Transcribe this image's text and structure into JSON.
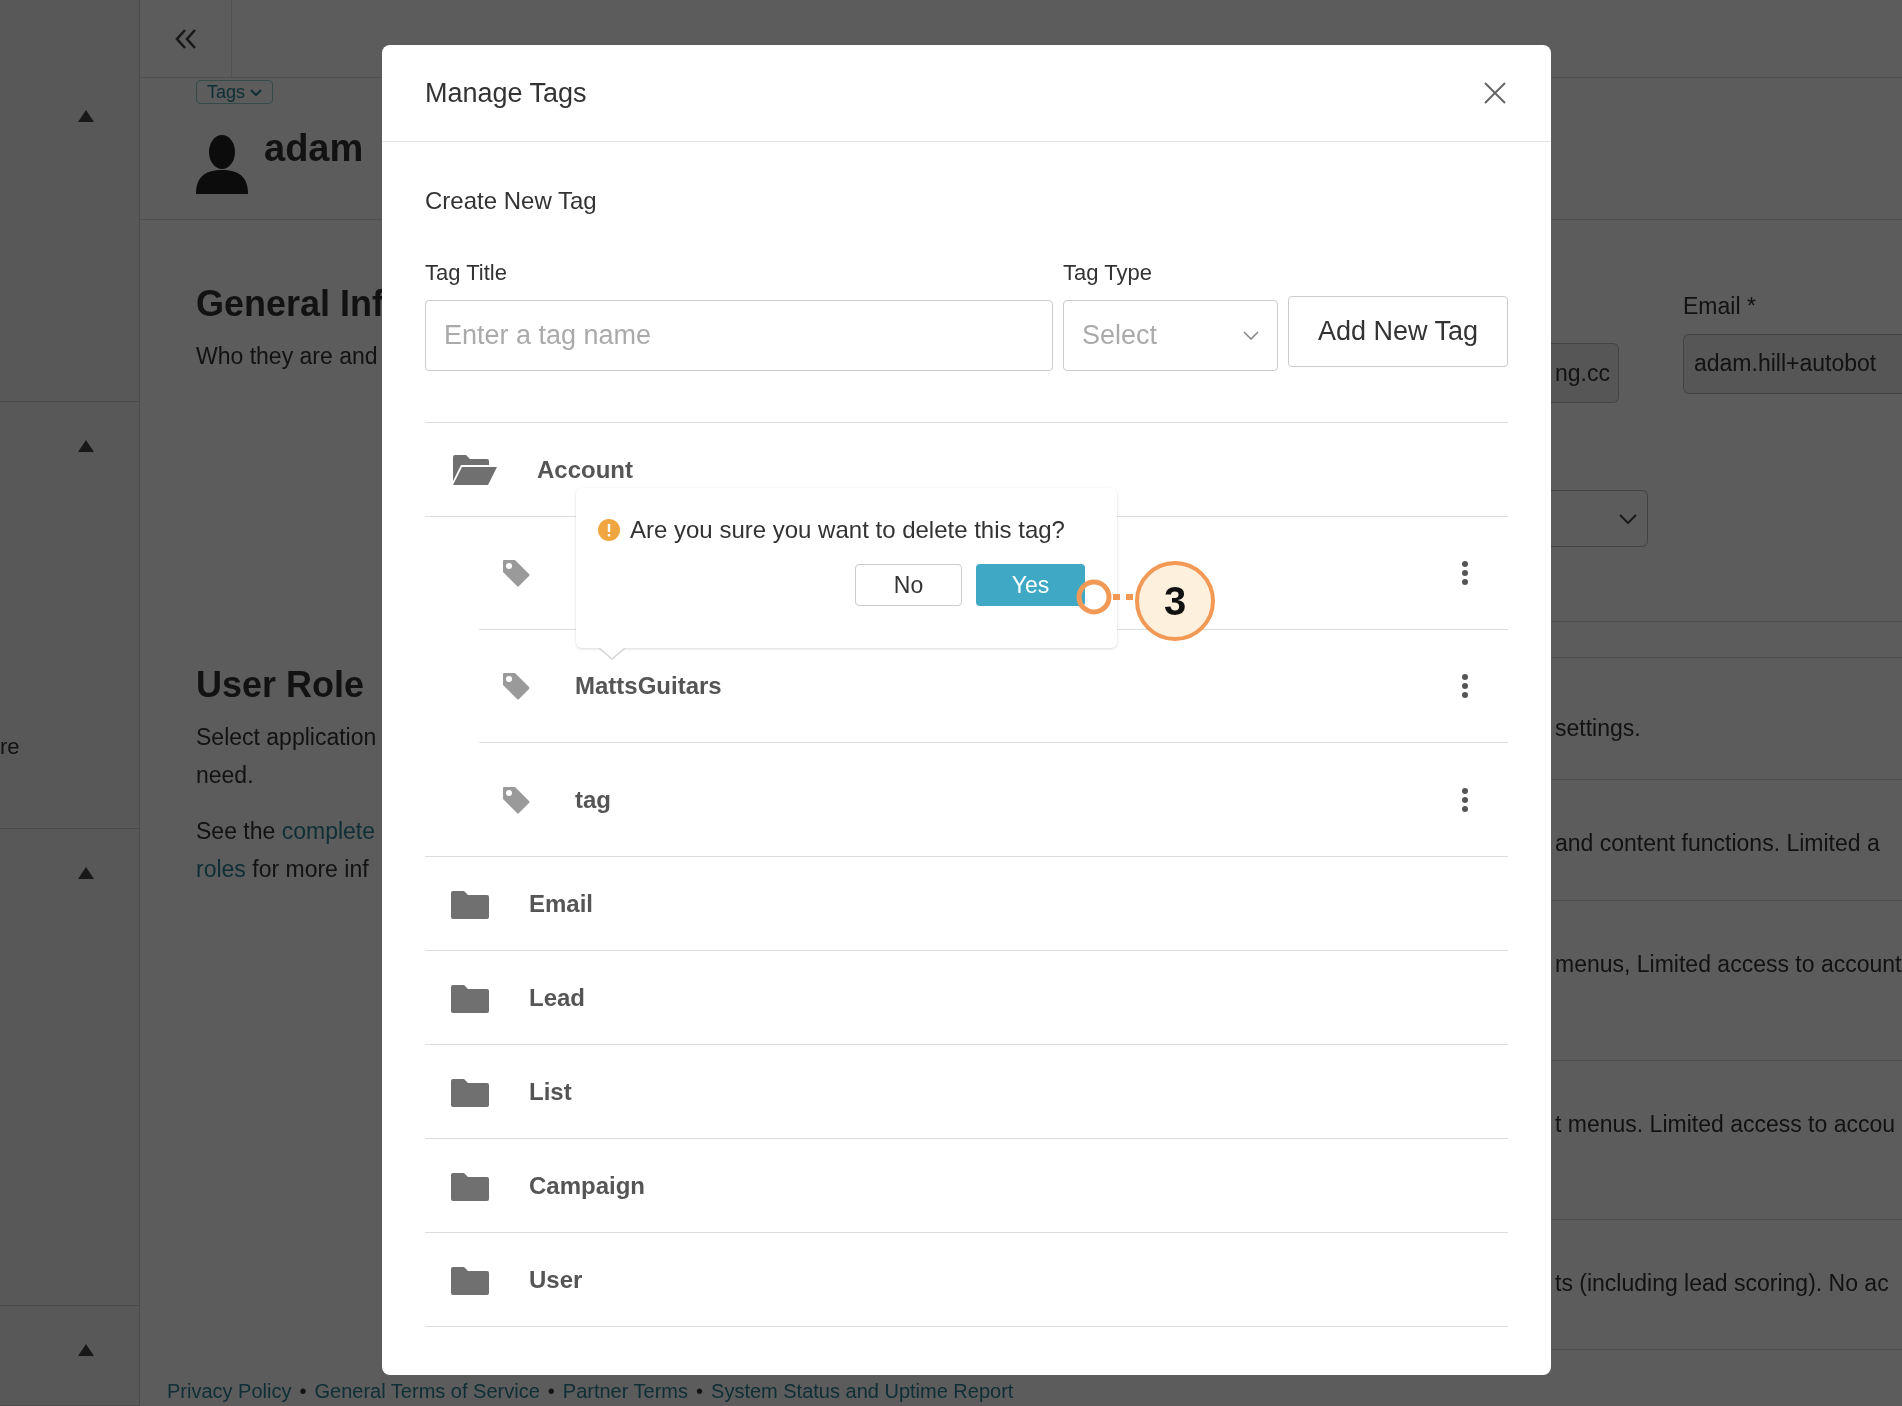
{
  "page": {
    "sidebar": {
      "sections": [
        {
          "expanded": true
        },
        {
          "expanded": true,
          "text": "re"
        },
        {
          "expanded": true
        },
        {
          "expanded": true
        }
      ]
    },
    "tags_button": "Tags",
    "user_name": "adam",
    "sections": [
      {
        "title": "General Inf",
        "lines": [
          [
            {
              "kind": "text",
              "text": "Who they are and"
            }
          ]
        ]
      },
      {
        "title": "User Role",
        "lines": [
          [
            {
              "kind": "text",
              "text": "Select application"
            }
          ],
          [
            {
              "kind": "text",
              "text": "need."
            }
          ],
          [
            {
              "kind": "text",
              "text": "See the "
            },
            {
              "kind": "link",
              "text": "complete"
            }
          ],
          [
            {
              "kind": "link",
              "text": "roles"
            },
            {
              "kind": "text",
              "text": " for more inf"
            }
          ]
        ]
      }
    ],
    "right": {
      "field_fragment": "ng.cc",
      "email_label": "Email *",
      "email_value": "adam.hill+autobot",
      "role_texts": [
        "settings.",
        "and content functions. Limited a",
        "menus, Limited access to account",
        "t menus. Limited access to accou",
        "ts (including lead scoring). No ac"
      ]
    },
    "footer": {
      "links": [
        "Privacy Policy",
        "General Terms of Service",
        "Partner Terms",
        "System Status and Uptime Report"
      ],
      "separator": "•"
    }
  },
  "modal": {
    "title": "Manage Tags",
    "create_heading": "Create New Tag",
    "tag_title": {
      "label": "Tag Title",
      "placeholder": "Enter a tag name"
    },
    "tag_type": {
      "label": "Tag Type",
      "placeholder": "Select"
    },
    "add_button": "Add New Tag",
    "groups": [
      {
        "name": "Account",
        "expanded": true,
        "tags": [
          {
            "confirm": {
              "message": "Are you sure you want to delete this tag?",
              "no": "No",
              "yes": "Yes",
              "callout": "3"
            }
          },
          {
            "name": "MattsGuitars"
          },
          {
            "name": "tag"
          }
        ]
      },
      {
        "name": "Email",
        "expanded": false
      },
      {
        "name": "Lead",
        "expanded": false
      },
      {
        "name": "List",
        "expanded": false
      },
      {
        "name": "Campaign",
        "expanded": false
      },
      {
        "name": "User",
        "expanded": false
      }
    ]
  }
}
